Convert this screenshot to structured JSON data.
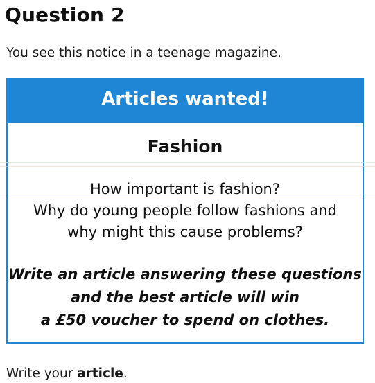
{
  "question": {
    "title": "Question 2"
  },
  "intro": "You see this notice in a teenage magazine.",
  "notice": {
    "header": "Articles wanted!",
    "topic": "Fashion",
    "questions": [
      "How important is fashion?",
      "Why do young people follow fashions and",
      "why might this cause problems?"
    ],
    "call_to_action": [
      "Write an article answering these questions",
      "and the best article will win",
      "a £50 voucher to spend on clothes."
    ],
    "colors": {
      "accent": "#1f86d6",
      "header_text": "#ffffff"
    }
  },
  "footer": {
    "prefix": "Write your ",
    "emphasis": "article",
    "suffix": "."
  }
}
